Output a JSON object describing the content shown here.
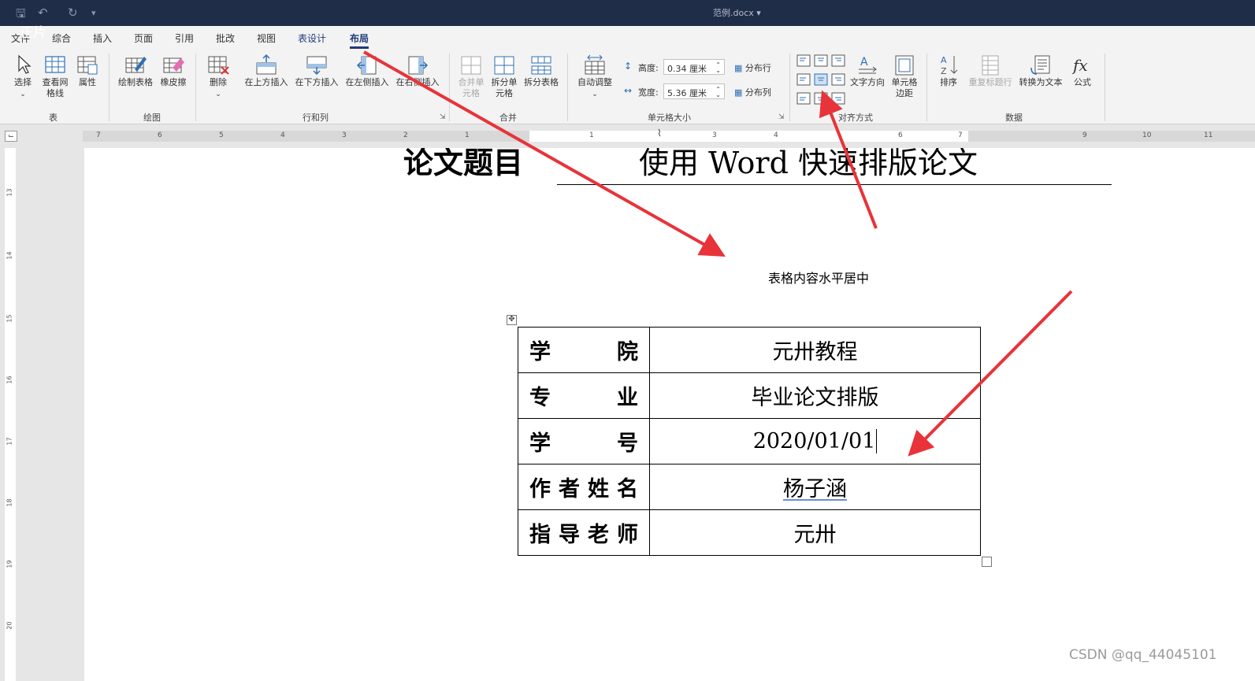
{
  "window": {
    "doc_title": "范例.docx",
    "overlay_text": "正片",
    "quick_access": [
      "save-icon",
      "undo-icon",
      "redo-icon",
      "customize-icon"
    ]
  },
  "ribbon": {
    "tabs": [
      "文件",
      "综合",
      "插入",
      "页面",
      "引用",
      "批改",
      "视图",
      "表设计",
      "布局"
    ],
    "active_tab": "布局",
    "groups": {
      "table": {
        "label": "表",
        "select": "选择",
        "gridlines": "查看网格线",
        "properties": "属性"
      },
      "draw": {
        "label": "绘图",
        "draw_table": "绘制表格",
        "eraser": "橡皮擦"
      },
      "rows_cols": {
        "label": "行和列",
        "delete": "删除",
        "insert_above": "在上方插入",
        "insert_below": "在下方插入",
        "insert_left": "在左侧插入",
        "insert_right": "在右侧插入"
      },
      "merge": {
        "label": "合并",
        "merge_cells": "合并单元格",
        "split_cells": "拆分单元格",
        "split_table": "拆分表格"
      },
      "cell_size": {
        "label": "单元格大小",
        "autofit": "自动调整",
        "height_label": "高度:",
        "height_value": "0.34 厘米",
        "width_label": "宽度:",
        "width_value": "5.36 厘米",
        "distribute_rows": "分布行",
        "distribute_cols": "分布列"
      },
      "alignment": {
        "label": "对齐方式",
        "text_direction": "文字方向",
        "cell_margins": "单元格边距"
      },
      "data": {
        "label": "数据",
        "sort": "排序",
        "repeat_header": "重复标题行",
        "convert_text": "转换为文本",
        "formula": "公式"
      }
    }
  },
  "ruler": {
    "h_numbers": [
      "7",
      "6",
      "5",
      "4",
      "3",
      "2",
      "1",
      "1",
      "3",
      "4",
      "6",
      "7",
      "9",
      "10",
      "11"
    ],
    "v_numbers": [
      "13",
      "14",
      "15",
      "16",
      "17",
      "18",
      "19",
      "20"
    ]
  },
  "document": {
    "heading_label": "论文题目",
    "heading_value": "使用 Word 快速排版论文",
    "annotation": "表格内容水平居中",
    "table": [
      {
        "label": [
          "学",
          "院"
        ],
        "value": "元卅教程"
      },
      {
        "label": [
          "专",
          "业"
        ],
        "value": "毕业论文排版"
      },
      {
        "label": [
          "学",
          "号"
        ],
        "value": "2020/01/01"
      },
      {
        "label": [
          "作",
          "者",
          "姓",
          "名"
        ],
        "value": "杨子涵"
      },
      {
        "label": [
          "指",
          "导",
          "老",
          "师"
        ],
        "value": "元卅"
      }
    ]
  },
  "credit": "CSDN @qq_44045101",
  "colors": {
    "titlebar": "#1f2d49",
    "arrow": "#e8333a",
    "accent": "#1f3b7a"
  }
}
